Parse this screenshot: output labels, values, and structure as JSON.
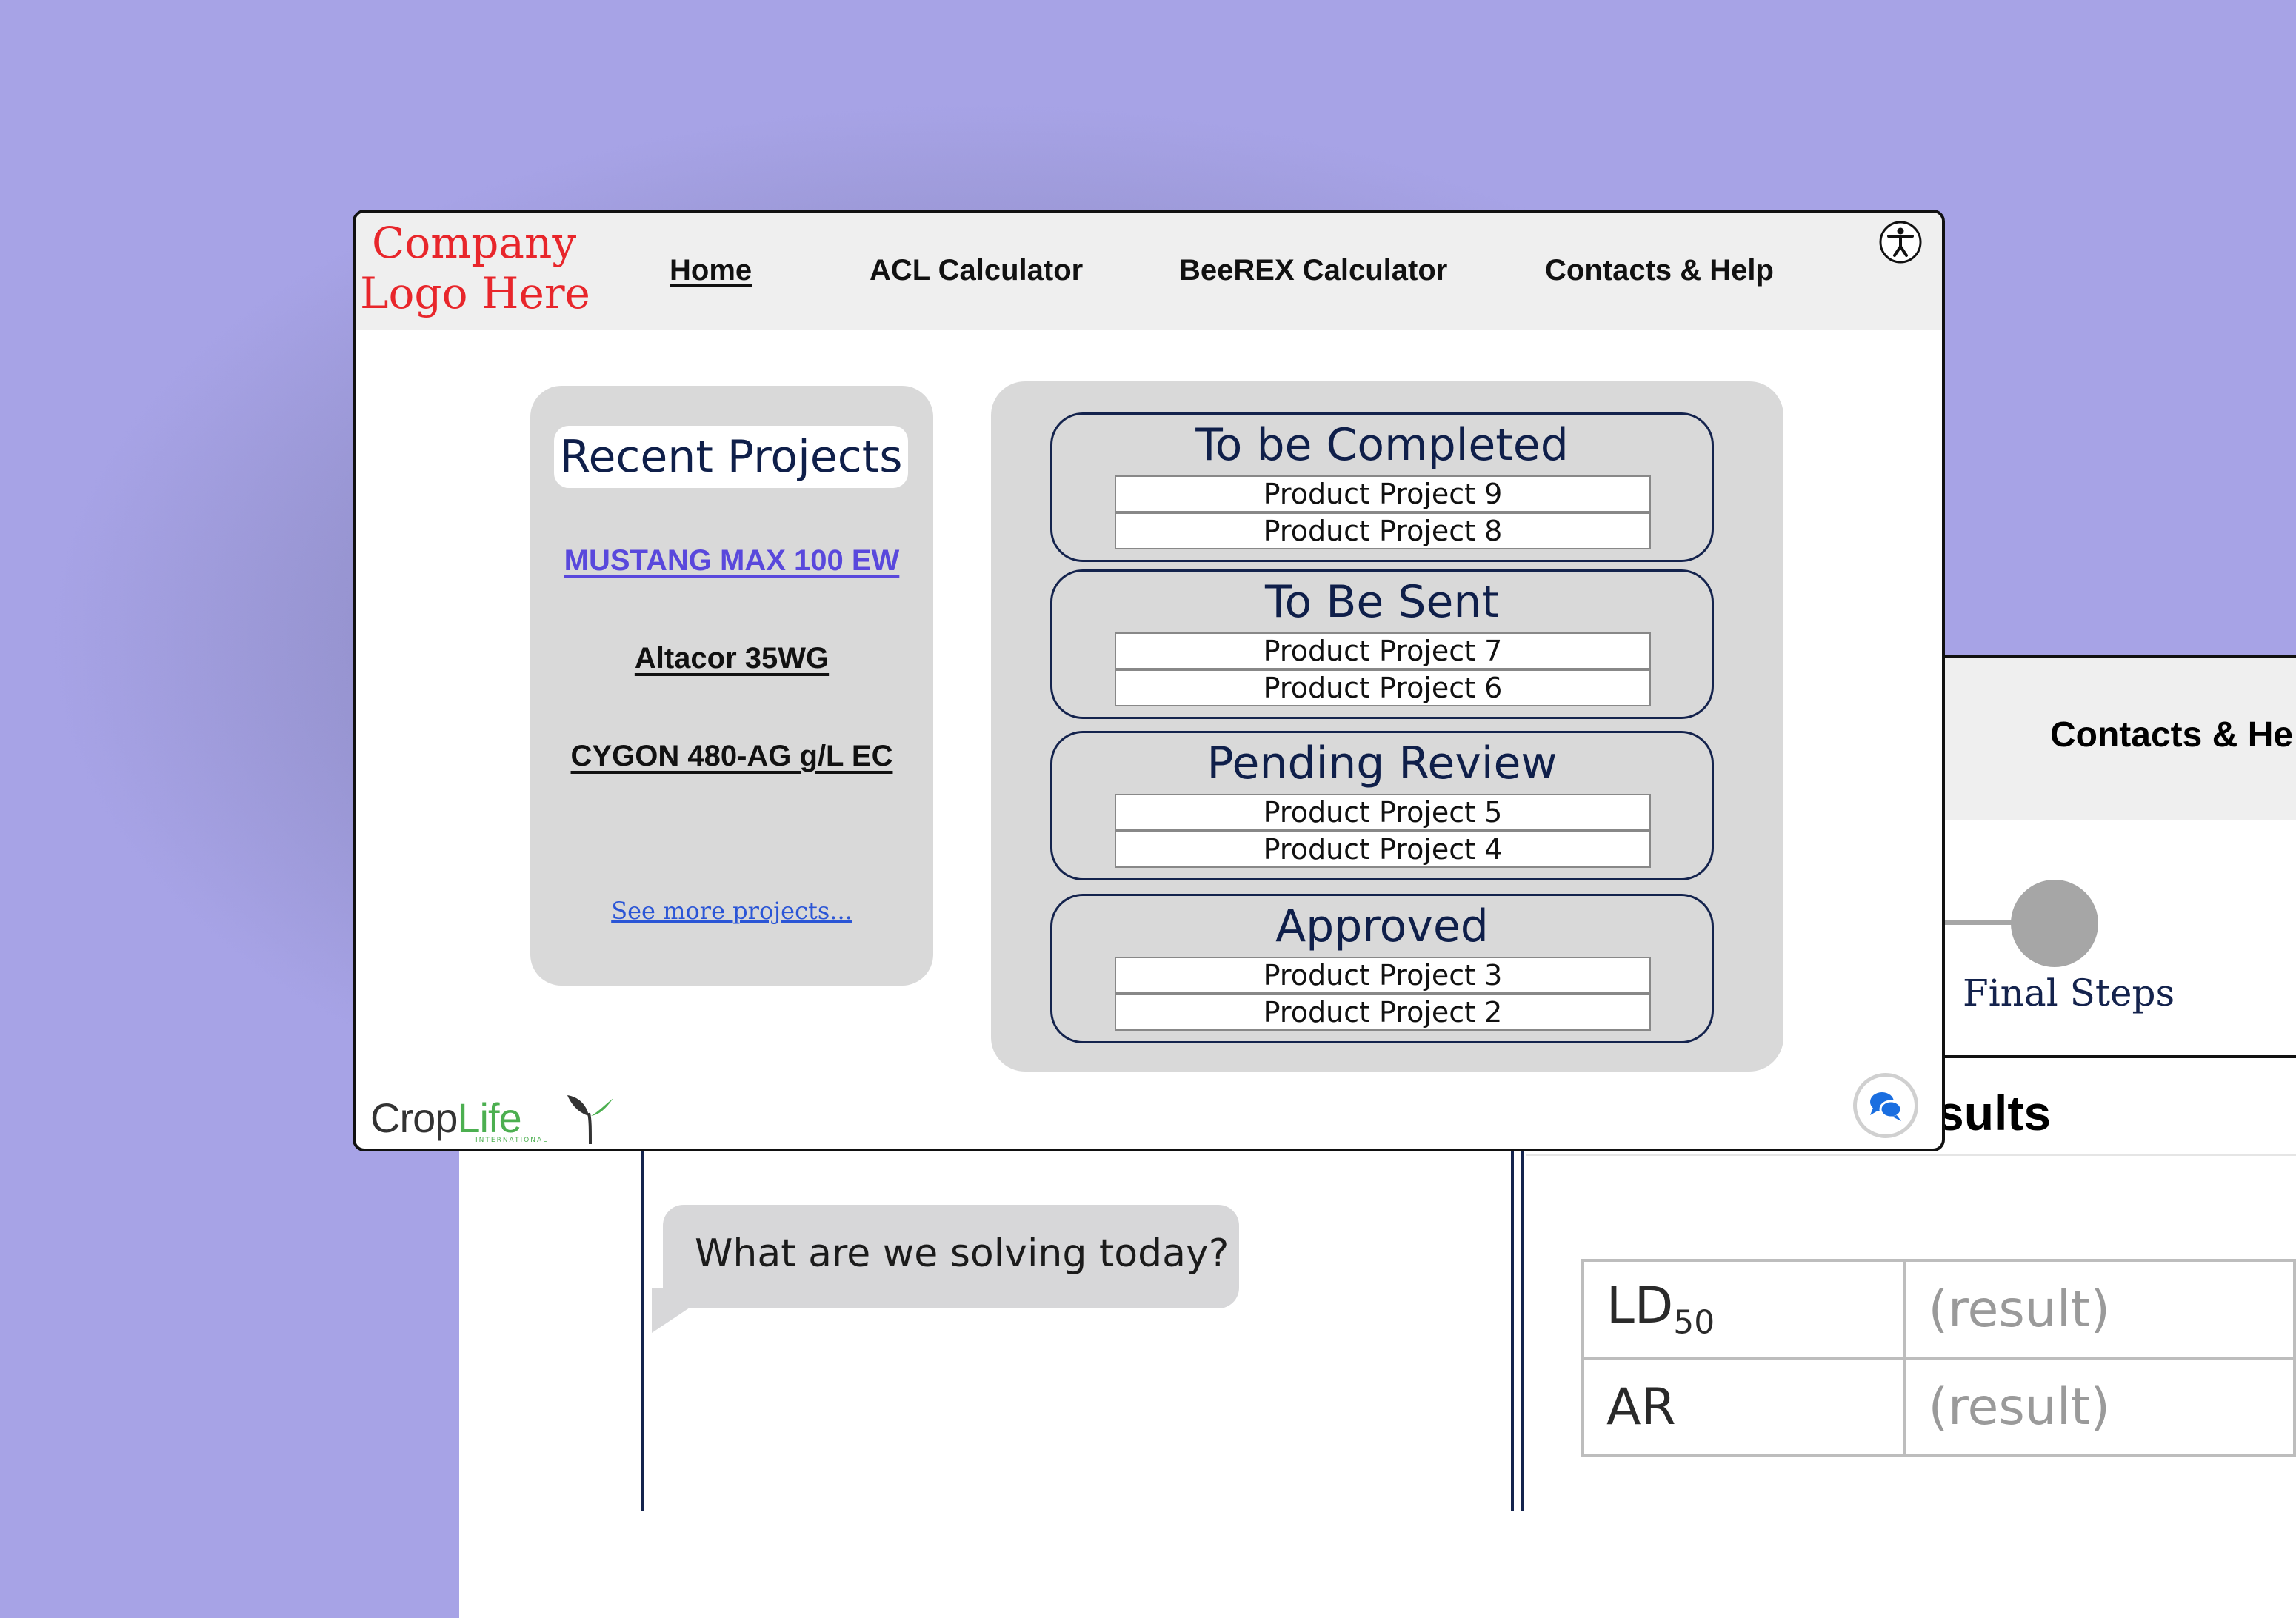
{
  "nav": {
    "logo_line1": "Company",
    "logo_line2": "Logo Here",
    "links": [
      {
        "label": "Home",
        "active": true
      },
      {
        "label": "ACL Calculator"
      },
      {
        "label": "BeeREX Calculator"
      },
      {
        "label": "Contacts & Help"
      }
    ],
    "accessibility_icon": "accessibility-icon"
  },
  "recent": {
    "title": "Recent Projects",
    "projects": [
      "MUSTANG MAX 100 EW",
      "Altacor 35WG",
      "CYGON 480-AG g/L EC"
    ],
    "see_more": "See more projects..."
  },
  "status": {
    "groups": [
      {
        "title": "To be Completed",
        "items": [
          "Product Project 9",
          "Product Project 8"
        ]
      },
      {
        "title": "To Be Sent",
        "items": [
          "Product Project 7",
          "Product Project 6"
        ]
      },
      {
        "title": "Pending Review",
        "items": [
          "Product Project 5",
          "Product Project 4"
        ]
      },
      {
        "title": "Approved",
        "items": [
          "Product Project 3",
          "Product Project 2"
        ]
      }
    ]
  },
  "footer": {
    "brand_crop": "Crop",
    "brand_life": "Life",
    "brand_sub": "INTERNATIONAL",
    "chat_icon": "chat-bubbles-icon"
  },
  "back_window": {
    "header_link": "Contacts & He",
    "step_label": "Final Steps",
    "results_title": "sults",
    "chat_message": "What are we solving today?",
    "results_rows": [
      {
        "key": "LD",
        "sub": "50",
        "value": "(result)"
      },
      {
        "key": "AR",
        "value": "(result)"
      }
    ]
  },
  "colors": {
    "accent_red": "#e8262b",
    "navy": "#0f1f4a",
    "link_purple": "#5948dc",
    "link_blue": "#2a55d6",
    "brand_green": "#4caf50"
  }
}
